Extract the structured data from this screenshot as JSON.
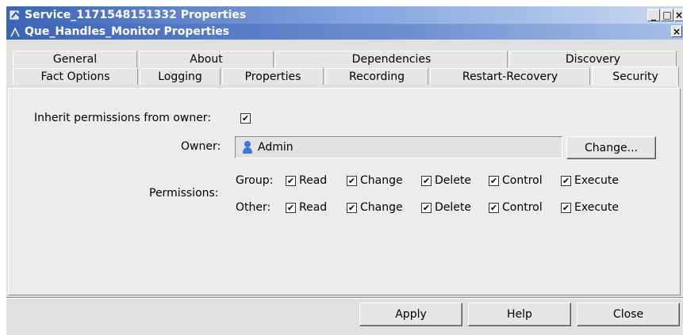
{
  "window": {
    "title": "Service_1171548151332 Properties",
    "subtitle": "Que_Handles_Monitor Properties",
    "minimize_glyph": "_",
    "maximize_glyph": "□",
    "close_glyph": "×"
  },
  "tabs_row1": [
    "General",
    "About",
    "Dependencies",
    "Discovery"
  ],
  "tabs_row2": [
    "Fact Options",
    "Logging",
    "Properties",
    "Recording",
    "Restart-Recovery",
    "Security"
  ],
  "active_tab": "Security",
  "security": {
    "inherit_label": "Inherit permissions from owner:",
    "inherit_checked": true,
    "owner_label": "Owner:",
    "owner_value": "Admin",
    "change_button": "Change...",
    "permissions_label": "Permissions:",
    "group_label": "Group:",
    "other_label": "Other:",
    "perm_names": [
      "Read",
      "Change",
      "Delete",
      "Control",
      "Execute"
    ],
    "group_checked": [
      true,
      true,
      true,
      true,
      true
    ],
    "other_checked": [
      true,
      true,
      true,
      true,
      true
    ]
  },
  "footer": {
    "apply": "Apply",
    "help": "Help",
    "close": "Close"
  }
}
